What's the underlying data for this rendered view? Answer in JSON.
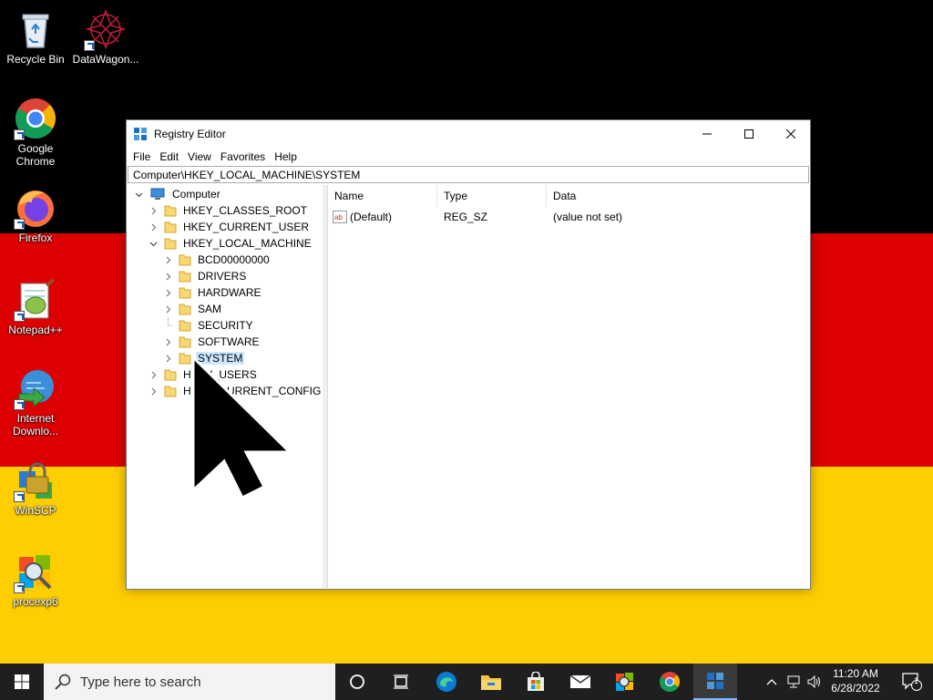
{
  "desktop": {
    "icons": [
      {
        "label": "Recycle Bin",
        "icon": "recycle-bin-icon"
      },
      {
        "label": "DataWagon...",
        "icon": "datawagon-icon"
      },
      {
        "label": "Google Chrome",
        "icon": "chrome-icon"
      },
      {
        "label": "Firefox",
        "icon": "firefox-icon"
      },
      {
        "label": "Notepad++",
        "icon": "notepadpp-icon"
      },
      {
        "label": "Internet Downlo...",
        "icon": "idm-icon"
      },
      {
        "label": "WinSCP",
        "icon": "winscp-icon"
      },
      {
        "label": "procexp6",
        "icon": "procexp-icon"
      }
    ],
    "colors": {
      "black": "#000000",
      "red": "#dd0000",
      "gold": "#ffce00"
    }
  },
  "window": {
    "title": "Registry Editor",
    "menu": [
      "File",
      "Edit",
      "View",
      "Favorites",
      "Help"
    ],
    "address": "Computer\\HKEY_LOCAL_MACHINE\\SYSTEM",
    "tree": [
      {
        "label": "Computer",
        "chevron": "expanded"
      },
      {
        "label": "HKEY_CLASSES_ROOT",
        "chevron": "collapsed"
      },
      {
        "label": "HKEY_CURRENT_USER",
        "chevron": "collapsed"
      },
      {
        "label": "HKEY_LOCAL_MACHINE",
        "chevron": "expanded"
      },
      {
        "label": "BCD00000000",
        "chevron": "collapsed"
      },
      {
        "label": "DRIVERS",
        "chevron": "collapsed"
      },
      {
        "label": "HARDWARE",
        "chevron": "collapsed"
      },
      {
        "label": "SAM",
        "chevron": "collapsed"
      },
      {
        "label": "SECURITY",
        "chevron": "none"
      },
      {
        "label": "SOFTWARE",
        "chevron": "collapsed"
      },
      {
        "label": "SYSTEM",
        "chevron": "collapsed",
        "selected": true
      },
      {
        "label": "HKEY_USERS",
        "chevron": "collapsed"
      },
      {
        "label": "HKEY_CURRENT_CONFIG",
        "chevron": "collapsed"
      }
    ],
    "columns": [
      "Name",
      "Type",
      "Data"
    ],
    "values": [
      {
        "name": "(Default)",
        "type": "REG_SZ",
        "data": "(value not set)"
      }
    ]
  },
  "taskbar": {
    "search_placeholder": "Type here to search",
    "pinned": [
      "task-view-icon",
      "edge-icon",
      "file-explorer-icon",
      "store-icon",
      "mail-icon",
      "procexp-icon",
      "chrome-icon",
      "regedit-icon"
    ],
    "clock_time": "11:20 AM",
    "clock_date": "6/28/2022",
    "notification_count": "1"
  }
}
